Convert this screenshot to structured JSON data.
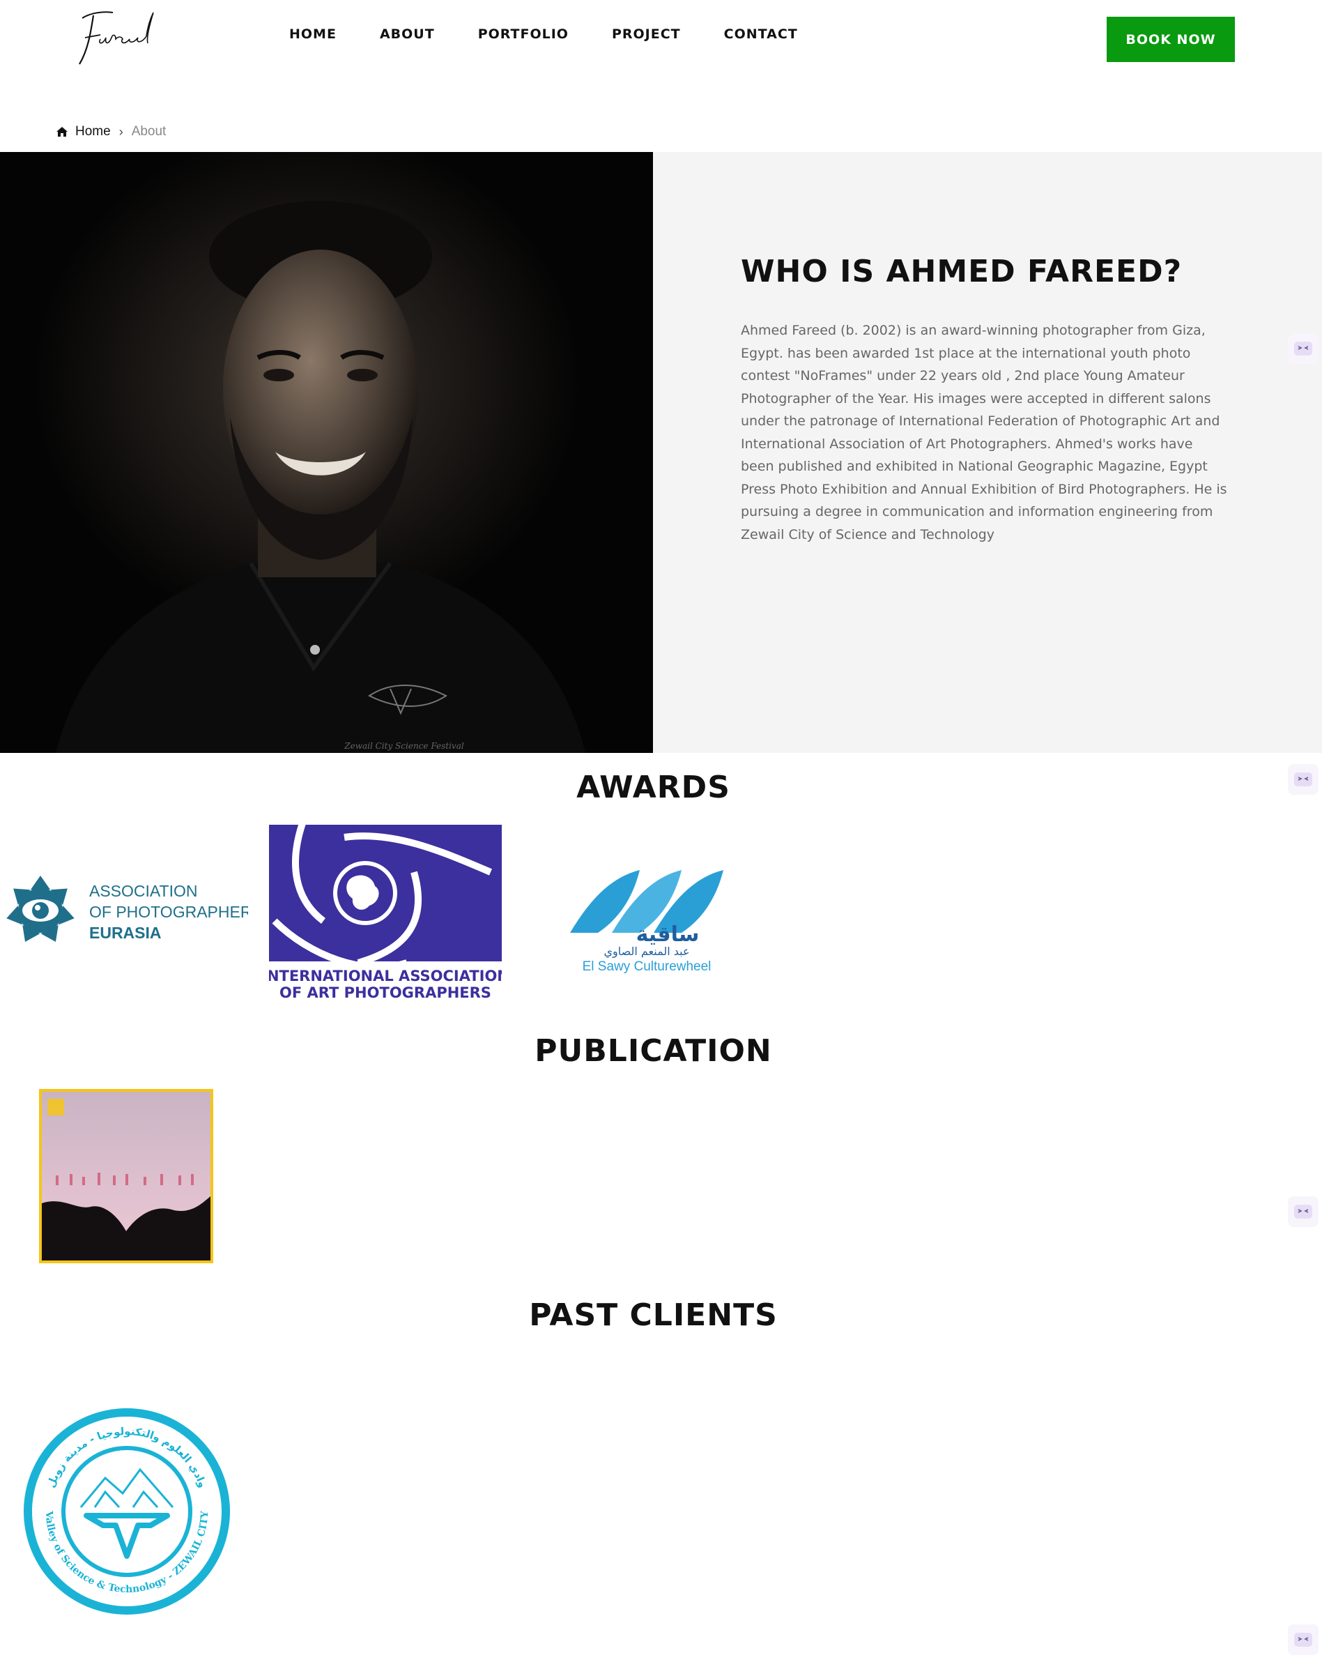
{
  "header": {
    "logo_text": "Fareed",
    "nav": [
      {
        "label": "HOME"
      },
      {
        "label": "ABOUT"
      },
      {
        "label": "PORTFOLIO"
      },
      {
        "label": "PROJECT"
      },
      {
        "label": "CONTACT"
      }
    ],
    "book_button": "BOOK NOW"
  },
  "breadcrumb": {
    "home_icon": "home-icon",
    "home": "Home",
    "separator": "›",
    "current": "About"
  },
  "hero": {
    "title": "WHO IS AHMED FAREED?",
    "body": "Ahmed Fareed (b. 2002) is an award-winning photographer from Giza, Egypt. has been awarded 1st place at the international youth photo contest \"NoFrames\" under 22 years old , 2nd place Young Amateur Photographer of the Year. His images were accepted in different salons under the patronage of International Federation of Photographic Art and International Association of Art Photographers. Ahmed's works have been published and exhibited in National Geographic Magazine, Egypt Press Photo Exhibition and Annual Exhibition of Bird Photographers. He is pursuing a degree in communication and information engineering from Zewail City of Science and Technology",
    "photo_caption": "Zewail City Science Festival"
  },
  "awards": {
    "title": "AWARDS",
    "logos": [
      {
        "line1": "ASSOCIATION",
        "line2": "OF PHOTOGRAPHERS",
        "line3": "EURASIA"
      },
      {
        "line1": "INTERNATIONAL ASSOCIATION",
        "line2": "OF ART PHOTOGRAPHERS"
      },
      {
        "arabic": "ساقية",
        "arabic_sub": "عبد المنعم الصاوي",
        "latin": "El Sawy Culturewheel"
      }
    ]
  },
  "publication": {
    "title": "PUBLICATION"
  },
  "clients": {
    "title": "PAST CLIENTS",
    "logo_arabic": "وادي العلوم والتكنولوجيا - مدينة زويل",
    "logo_latin": "Valley of Science & Technology - ZEWAIL CITY"
  },
  "colors": {
    "accent_green": "#0a9a10",
    "pub_border": "#f5c518",
    "hero_panel_bg": "#f4f4f4",
    "eurasia_teal": "#1f6f8b",
    "iaap_blue": "#3c2f9e",
    "sawy_blue": "#2a9fd6",
    "zewail_cyan": "#1ab3d6"
  }
}
